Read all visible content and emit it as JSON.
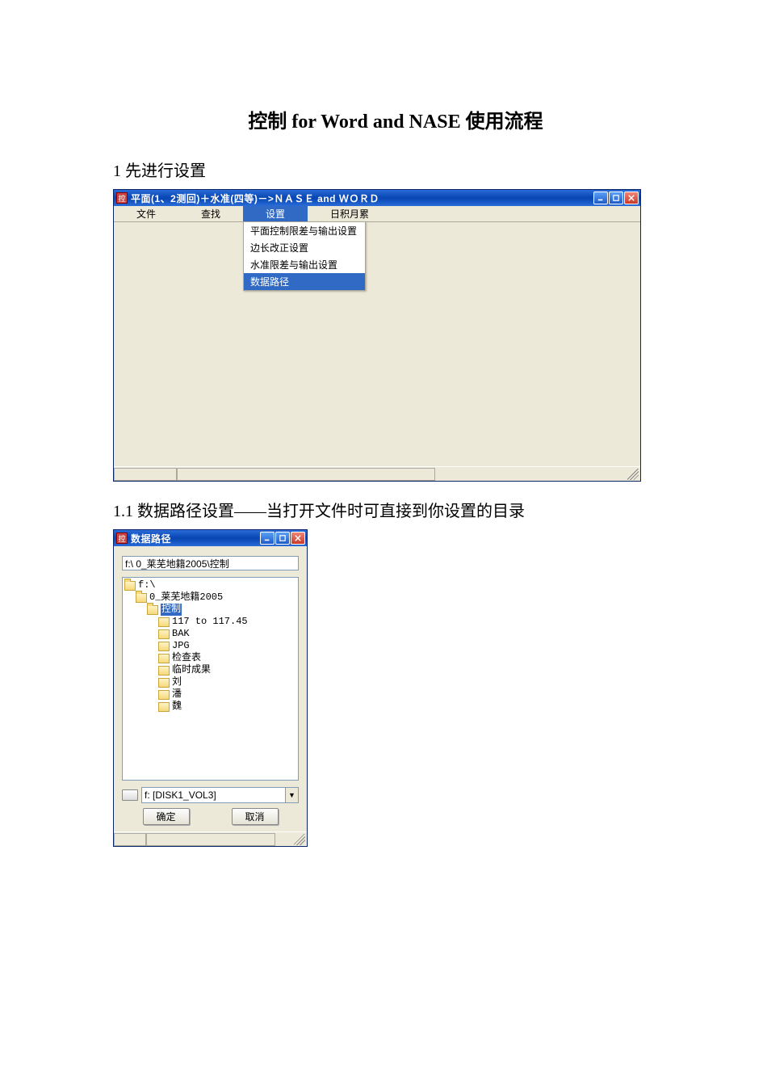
{
  "doc": {
    "title": "控制 for Word and NASE 使用流程",
    "section1": "1 先进行设置",
    "section11": "1.1 数据路径设置——当打开文件时可直接到你设置的目录"
  },
  "app": {
    "title": "平面(1、2测回)＋水准(四等)－>ＮＡＳＥ and ＷＯＲＤ",
    "menu": {
      "file": "文件",
      "find": "查找",
      "settings": "设置",
      "notes": "日积月累"
    },
    "settings_dropdown": {
      "item1": "平面控制限差与输出设置",
      "item2": "边长改正设置",
      "item3": "水准限差与输出设置",
      "item4": "数据路径"
    }
  },
  "dialog": {
    "title": "数据路径",
    "path_value": "f:\\ 0_莱芜地籍2005\\控制",
    "tree": {
      "root": "f:\\",
      "n1": "0_莱芜地籍2005",
      "n2": "控制",
      "c1": "117 to 117.45",
      "c2": "BAK",
      "c3": "JPG",
      "c4": "检查表",
      "c5": "临时成果",
      "c6": "刘",
      "c7": "潘",
      "c8": "魏"
    },
    "drive_label": "f: [DISK1_VOL3]",
    "ok": "确定",
    "cancel": "取消"
  }
}
